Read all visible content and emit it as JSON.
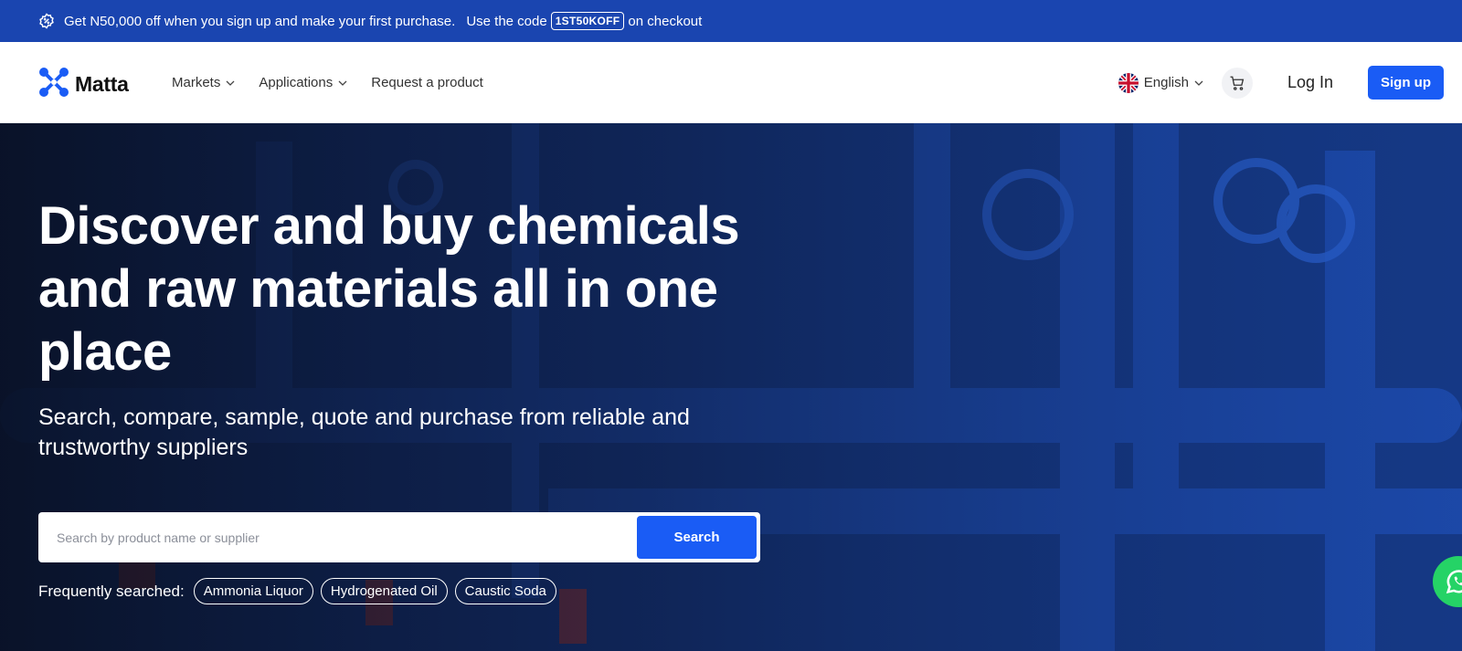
{
  "promo": {
    "text_before": "Get N50,000 off when you sign up and make your first purchase.",
    "text_code_intro": "Use the code",
    "code": "1ST50KOFF",
    "text_after": "on checkout",
    "icon": "discount-badge-icon"
  },
  "nav": {
    "logo_text": "Matta",
    "menu": [
      {
        "label": "Markets",
        "has_dropdown": true
      },
      {
        "label": "Applications",
        "has_dropdown": true
      },
      {
        "label": "Request a product",
        "has_dropdown": false
      }
    ],
    "language": "English",
    "cart_icon": "cart-icon",
    "login_label": "Log In",
    "signup_label": "Sign up"
  },
  "hero": {
    "headline": "Discover and buy chemicals and raw materials all in one place",
    "subheadline": "Search, compare, sample, quote and purchase from reliable and trustworthy suppliers",
    "search": {
      "placeholder": "Search by product name or supplier",
      "value": "",
      "button_label": "Search"
    },
    "frequently_searched": {
      "label": "Frequently searched:",
      "items": [
        "Ammonia Liquor",
        "Hydrogenated Oil",
        "Caustic Soda"
      ]
    }
  },
  "colors": {
    "promo_bg": "#1a45b0",
    "accent": "#1a5cf5",
    "whatsapp": "#25d366"
  }
}
